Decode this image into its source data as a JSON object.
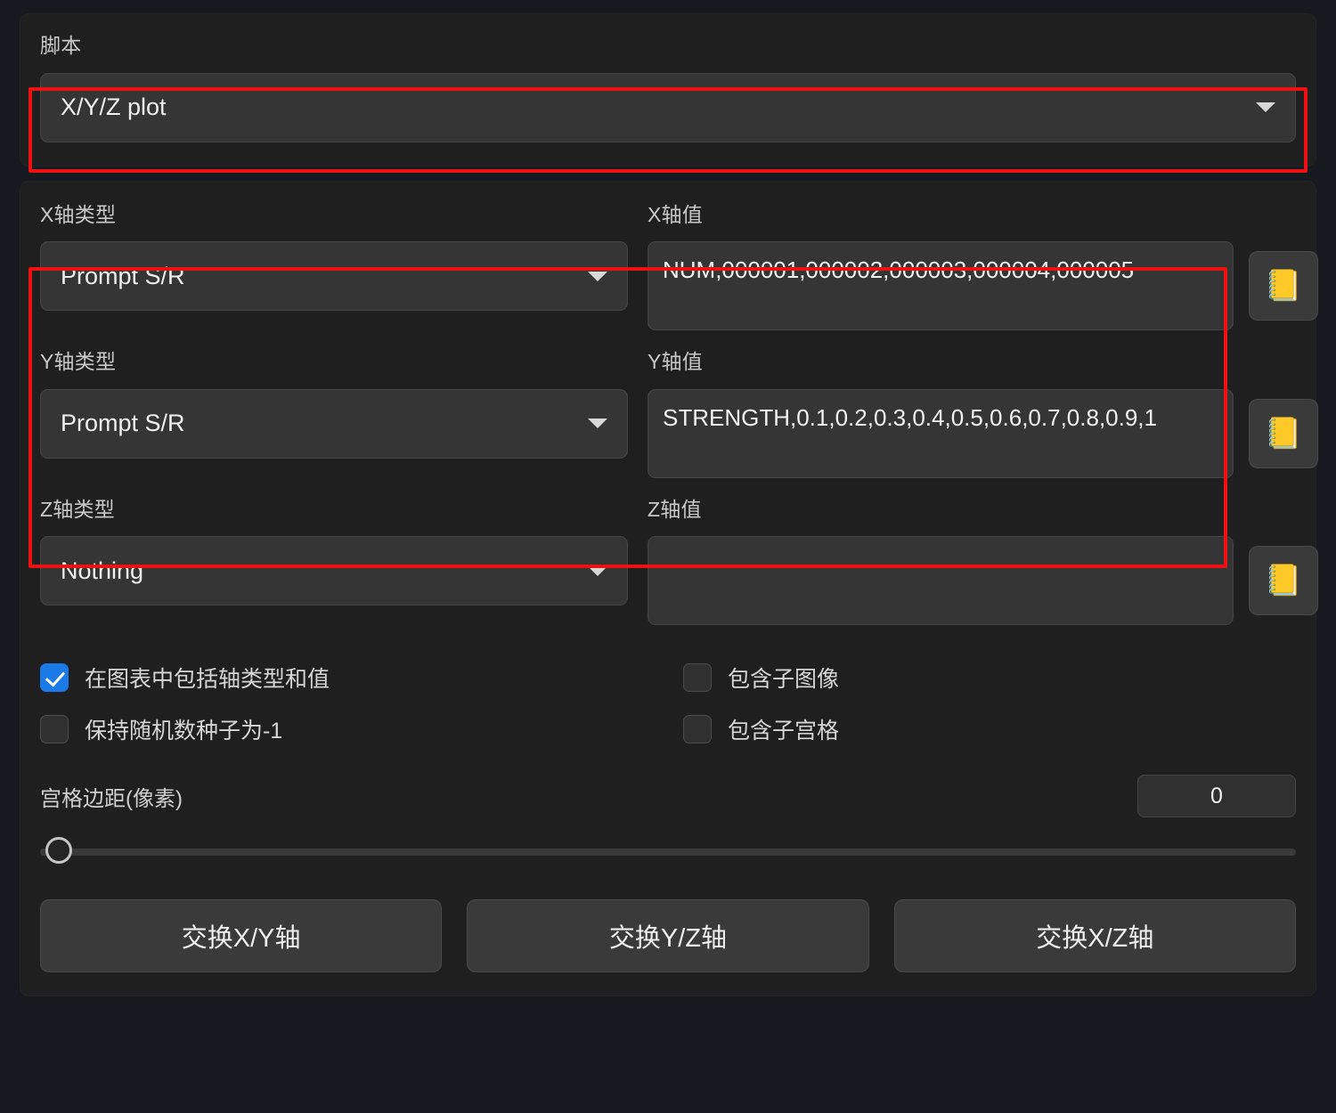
{
  "script_section": {
    "label": "脚本",
    "dropdown_value": "X/Y/Z plot",
    "caret_icon": "chevron-down-icon"
  },
  "axes": {
    "x": {
      "type_label": "X轴类型",
      "type_value": "Prompt S/R",
      "values_label": "X轴值",
      "values_value": "NUM,000001,000002,000003,000004,000005",
      "book_icon": "notebook-icon"
    },
    "y": {
      "type_label": "Y轴类型",
      "type_value": "Prompt S/R",
      "values_label": "Y轴值",
      "values_value": "STRENGTH,0.1,0.2,0.3,0.4,0.5,0.6,0.7,0.8,0.9,1",
      "book_icon": "notebook-icon"
    },
    "z": {
      "type_label": "Z轴类型",
      "type_value": "Nothing",
      "values_label": "Z轴值",
      "values_value": "",
      "book_icon": "notebook-icon"
    }
  },
  "options": {
    "left": [
      {
        "label": "在图表中包括轴类型和值",
        "checked": true
      },
      {
        "label": "保持随机数种子为-1",
        "checked": false
      }
    ],
    "right": [
      {
        "label": "包含子图像",
        "checked": false
      },
      {
        "label": "包含子宫格",
        "checked": false
      }
    ]
  },
  "margin": {
    "label": "宫格边距(像素)",
    "value": "0",
    "slider_position_percent": 0
  },
  "buttons": [
    {
      "label": "交换X/Y轴"
    },
    {
      "label": "交换Y/Z轴"
    },
    {
      "label": "交换X/Z轴"
    }
  ],
  "colors": {
    "highlight": "#ee1111",
    "checkbox_accent": "#1a7ae8",
    "panel_bg": "#1f1f1f",
    "page_bg": "#161920",
    "control_bg": "#353535"
  },
  "icons": {
    "notebook": "📒"
  }
}
